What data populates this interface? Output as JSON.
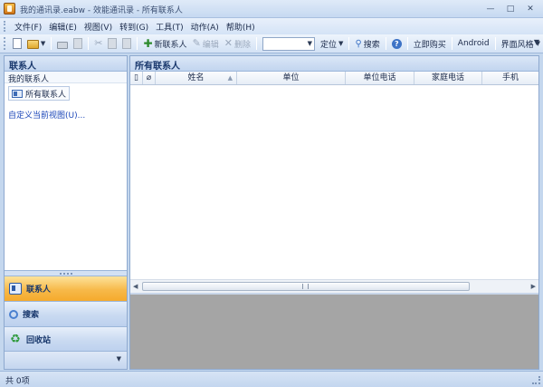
{
  "window": {
    "title": "我的通讯录.eabw - 效能通讯录 - 所有联系人",
    "minimize": "—",
    "maximize": "□",
    "close": "✕"
  },
  "menu": [
    "文件(F)",
    "编辑(E)",
    "视图(V)",
    "转到(G)",
    "工具(T)",
    "动作(A)",
    "帮助(H)"
  ],
  "toolbar": {
    "new_contact": "新联系人",
    "edit": "编辑",
    "delete": "删除",
    "search_value": "",
    "locate": "定位",
    "search": "搜索",
    "buy": "立即购买",
    "android": "Android",
    "theme": "界面风格"
  },
  "left_panel": {
    "header": "联系人",
    "section": "我的联系人",
    "item": "所有联系人",
    "custom_view_link": "自定义当前视图(U)..."
  },
  "nav": {
    "contacts": "联系人",
    "search": "搜索",
    "recycle": "回收站"
  },
  "right_panel": {
    "header": "所有联系人",
    "columns": [
      "姓名",
      "单位",
      "单位电话",
      "家庭电话",
      "手机"
    ]
  },
  "status": {
    "text": "共 0项"
  },
  "colors": {
    "accent_orange": "#f7b94a",
    "header_blue": "#c2d5ef",
    "link_blue": "#1b46b8"
  }
}
